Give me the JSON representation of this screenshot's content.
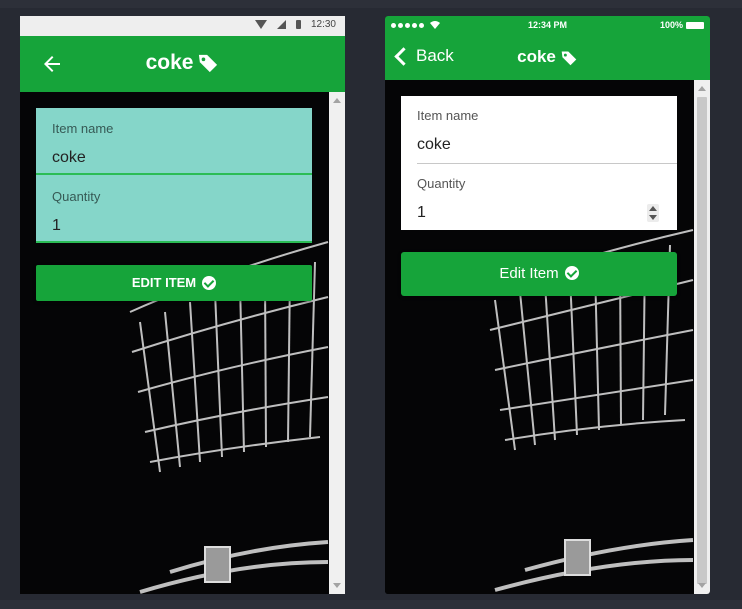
{
  "android": {
    "status": {
      "time": "12:30"
    },
    "appbar": {
      "title": "coke"
    },
    "form": {
      "item_name_label": "Item name",
      "item_name_value": "coke",
      "quantity_label": "Quantity",
      "quantity_value": "1"
    },
    "button": {
      "label": "EDIT ITEM"
    }
  },
  "ios": {
    "status": {
      "time": "12:34 PM",
      "battery": "100%"
    },
    "navbar": {
      "back_label": "Back",
      "title": "coke"
    },
    "form": {
      "item_name_label": "Item name",
      "item_name_value": "coke",
      "quantity_label": "Quantity",
      "quantity_value": "1"
    },
    "button": {
      "label": "Edit Item"
    }
  },
  "colors": {
    "brand_green": "#16a43a",
    "android_form_bg": "#85d6c9",
    "underline_green": "#2bbd55",
    "page_bg": "#272a33"
  },
  "icons": [
    "arrow-left-icon",
    "tag-icon",
    "check-circle-icon",
    "chevron-left-icon",
    "wifi-icon",
    "signal-icon",
    "battery-icon",
    "spinner-icon"
  ]
}
